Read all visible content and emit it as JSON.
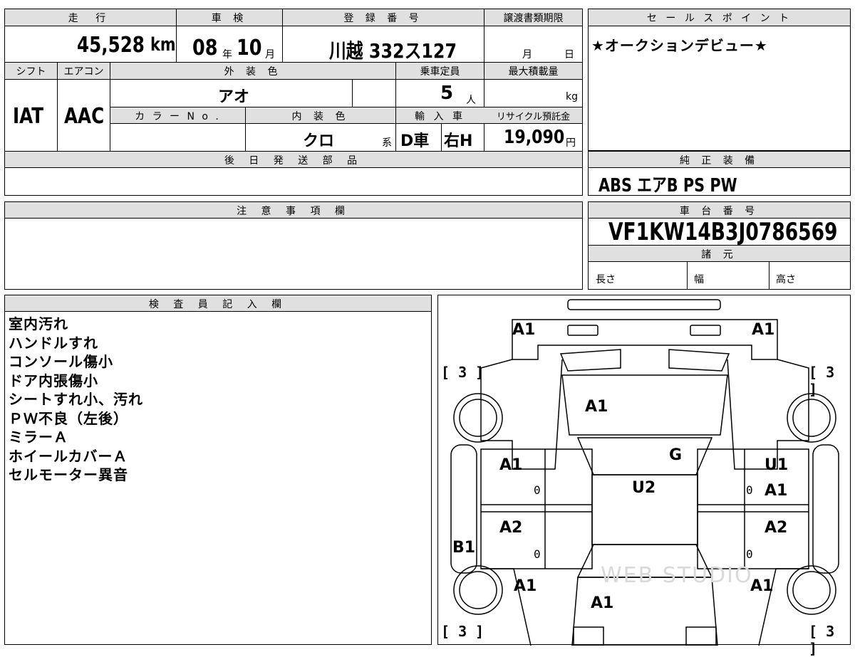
{
  "top_row_headers": {
    "mileage_label": "走 行",
    "shaken_label": "車 検",
    "reg_label": "登 録 番 号",
    "transfer_label": "譲渡書類期限",
    "sales_label": "セ ー ル ス ポ イ ン ト"
  },
  "values": {
    "mileage": "45,528",
    "mileage_unit": "km",
    "shaken_year": "08",
    "shaken_year_unit": "年",
    "shaken_month": "10",
    "shaken_month_unit": "月",
    "registration": "川越 332ス127",
    "transfer_month_unit": "月",
    "transfer_day_unit": "日"
  },
  "sales_point": "★オークションデビュー★",
  "row2_headers": {
    "shift": "シフト",
    "aircon": "エアコン",
    "exterior": "外 装 色",
    "capacity": "乗車定員",
    "max_load": "最大積載量",
    "color_no": "カ ラ ー N o .",
    "interior": "内 装 色",
    "import": "輸 入 車",
    "recycle": "リサイクル預託金"
  },
  "row2_values": {
    "shift": "IAT",
    "aircon": "AAC",
    "exterior_color": "アオ",
    "capacity": "5",
    "capacity_unit": "人",
    "load_unit": "kg",
    "interior_color": "クロ",
    "interior_suffix": "系",
    "import_type": "D車",
    "handle": "右H",
    "recycle_fee": "19,090",
    "recycle_unit": "円"
  },
  "later_parts_label": "後 日 発 送 部 品",
  "standard_equipment_label": "純 正 装 備",
  "standard_equipment": "ABS エアB PS PW",
  "caution_label": "注 意 事 項 欄",
  "chassis_label": "車 台 番 号",
  "chassis_number": "VF1KW14B3J0786569",
  "specs_label": "諸 元",
  "specs": {
    "length": "長さ",
    "width": "幅",
    "height": "高さ"
  },
  "inspector_label": "検 査 員 記 入 欄",
  "inspector_notes": [
    "室内汚れ",
    "ハンドルすれ",
    "コンソール傷小",
    "ドア内張傷小",
    "シートすれ小、汚れ",
    "ＰＷ不良（左後）",
    "ミラーＡ",
    "ホイールカバーＡ",
    "セルモーター異音"
  ],
  "diagram": {
    "front_left": "A1",
    "front_right": "A1",
    "tire_front_left": "[ 3 ]",
    "tire_front_right": "[ 3 ]",
    "tire_rear_left": "[ 3 ]",
    "tire_rear_right": "[ 3 ]",
    "hood": "A1",
    "windshield": "G",
    "roof": "U2",
    "front_door_left": "A1",
    "front_door_left_count": "0",
    "rear_door_left": "A2",
    "rear_door_left_count": "0",
    "rocker_left": "B1",
    "front_door_right_top": "U1",
    "front_door_right": "A1",
    "front_door_right_count": "0",
    "rear_door_right": "A2",
    "rear_door_right_count": "0",
    "rear_fender_left": "A1",
    "rear_fender_right": "A1",
    "trunk": "A1",
    "watermark": "WEB STUDIO"
  }
}
